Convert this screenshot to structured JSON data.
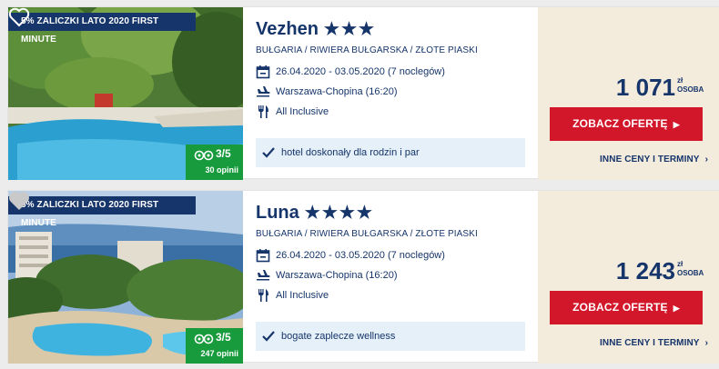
{
  "offers": [
    {
      "promo_label": "5% ZALICZKI LATO 2020 FIRST MINUTE",
      "favorite": true,
      "tripadvisor": {
        "score": "3/5",
        "reviews": "30 opinii"
      },
      "name": "Vezhen",
      "stars": "★★★",
      "star_count": 3,
      "location": "BUŁGARIA / RIWIERA BUŁGARSKA / ZŁOTE PIASKI",
      "dates": "26.04.2020 - 03.05.2020 (7 noclegów)",
      "departure": "Warszawa-Chopina (16:20)",
      "board": "All Inclusive",
      "highlight": "hotel doskonały dla rodzin i par",
      "price": "1 071",
      "currency": "zł",
      "per": "OSOBA",
      "cta": "ZOBACZ OFERTĘ",
      "more": "INNE CENY I TERMINY"
    },
    {
      "promo_label": "5% ZALICZKI LATO 2020 FIRST MINUTE",
      "favorite": false,
      "tripadvisor": {
        "score": "3/5",
        "reviews": "247 opinii"
      },
      "name": "Luna",
      "stars": "★★★★",
      "star_count": 4,
      "location": "BUŁGARIA / RIWIERA BUŁGARSKA / ZŁOTE PIASKI",
      "dates": "26.04.2020 - 03.05.2020 (7 noclegów)",
      "departure": "Warszawa-Chopina (16:20)",
      "board": "All Inclusive",
      "highlight": "bogate zaplecze wellness",
      "price": "1 243",
      "currency": "zł",
      "per": "OSOBA",
      "cta": "ZOBACZ OFERTĘ",
      "more": "INNE CENY I TERMINY"
    }
  ],
  "colors": {
    "navy": "#15356b",
    "red": "#d3172a",
    "price_bg": "#f3ebdc",
    "highlight_bg": "#e6f0f8",
    "tripadvisor": "#179b3c"
  },
  "icons": [
    "heart-icon",
    "tripadvisor-owl-icon",
    "calendar-icon",
    "plane-icon",
    "cutlery-icon",
    "checkmark-icon",
    "chevron-right-icon",
    "caret-right-icon"
  ]
}
